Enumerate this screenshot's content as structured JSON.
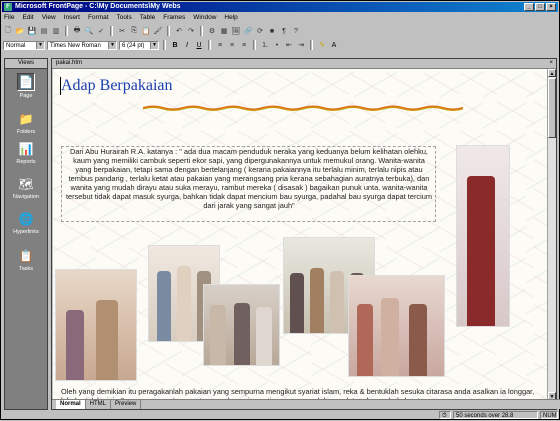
{
  "window": {
    "title": "Microsoft FrontPage - C:\\My Documents\\My Webs",
    "app_icon": "frontpage-icon"
  },
  "menu": [
    "File",
    "Edit",
    "View",
    "Insert",
    "Format",
    "Tools",
    "Table",
    "Frames",
    "Window",
    "Help"
  ],
  "format_toolbar": {
    "style": "Normal",
    "font": "Times New Roman",
    "size": "6 (24 pt)",
    "bold": "B",
    "italic": "I",
    "underline": "U"
  },
  "views": {
    "header": "Views",
    "items": [
      {
        "label": "Page",
        "icon": "page-icon",
        "active": true
      },
      {
        "label": "Folders",
        "icon": "folder-icon",
        "active": false
      },
      {
        "label": "Reports",
        "icon": "reports-icon",
        "active": false
      },
      {
        "label": "Navigation",
        "icon": "navigation-icon",
        "active": false
      },
      {
        "label": "Hyperlinks",
        "icon": "hyperlinks-icon",
        "active": false
      },
      {
        "label": "Tasks",
        "icon": "tasks-icon",
        "active": false
      }
    ]
  },
  "document": {
    "tab_name": "pakai.htm",
    "heading": "Adap Berpakaian",
    "quote": "Dari Abu Hurairah R.A. katanya : \" ada dua macam penduduk neraka yang keduanya belum kelihatan olehku, kaum yang memiliki cambuk seperti ekor sapi, yang dipergunakannya untuk memukul orang. Wanita-wanita yang berpakaian, tetapi sama dengan bertelanjang ( kerana pakaiannya itu terlalu minim, terlalu nipis atau tembus pandang , terlalu ketat atau pakaian yang merangsang pria kerana sebahagian auratnya terbuka), dan wanita yang mudah dirayu atau suka merayu, rambut mereka ( disasak ) bagaikan punuk unta. wanita-wanita tersebut tidak dapat masuk syurga, bahkan tidak dapat mencium bau syurga, padahal bau syurga dapat tercium dari jarak yang sangat jauh\"",
    "caption": "Oleh yang demikian itu peragakanlah pakaian yang sempurna mengikut syariat islam, reka & bentuklah sesuka citarasa anda asalkan ia longgar, labuh , tidak nipis & mampu menutup aurat sepenuhnya, ia pasti menawan malah mendatangkan pahala buat"
  },
  "bottom_tabs": [
    "Normal",
    "HTML",
    "Preview"
  ],
  "status": {
    "timing": "50 seconds over 28.8",
    "mode": "NUM"
  }
}
